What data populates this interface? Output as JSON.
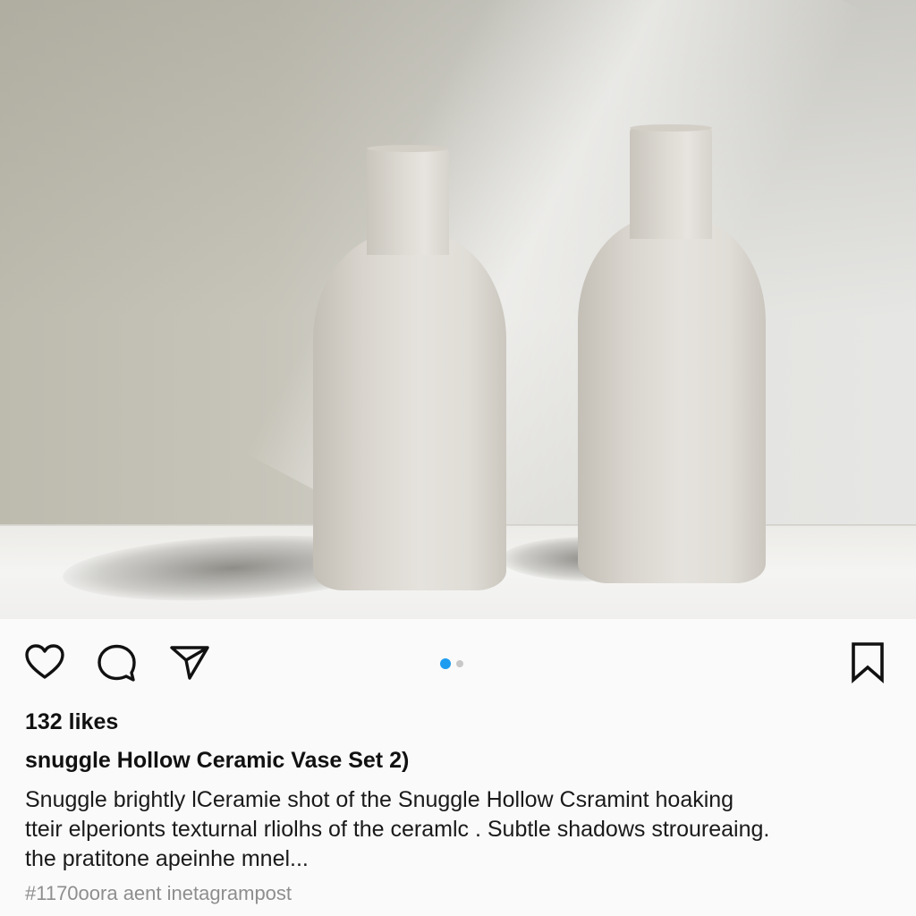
{
  "post": {
    "likes": "132 likes",
    "title": "snuggle Hollow Ceramic Vase Set 2)",
    "caption_lines": [
      "Snuggle brightly lCeramie shot of the Snuggle Hollow Csramint hoaking",
      "tteir elperionts texturnal rliolhs of the ceramlc . Subtle shadows stroureaing.",
      "the pratitone apeinhe mnel..."
    ],
    "tags": "#1170oora aent inetagrampost"
  },
  "actions": {
    "like_icon": "heart-outline-icon",
    "comment_icon": "speech-bubble-icon",
    "share_icon": "paper-plane-icon",
    "save_icon": "bookmark-outline-icon"
  },
  "carousel": {
    "total_slides": 2,
    "active_slide": 1,
    "active_color": "#1e9cf0",
    "inactive_color": "#c8c8c8"
  },
  "colors": {
    "background": "#fafafa",
    "text": "#111111",
    "muted_text": "#8e8e8e"
  }
}
